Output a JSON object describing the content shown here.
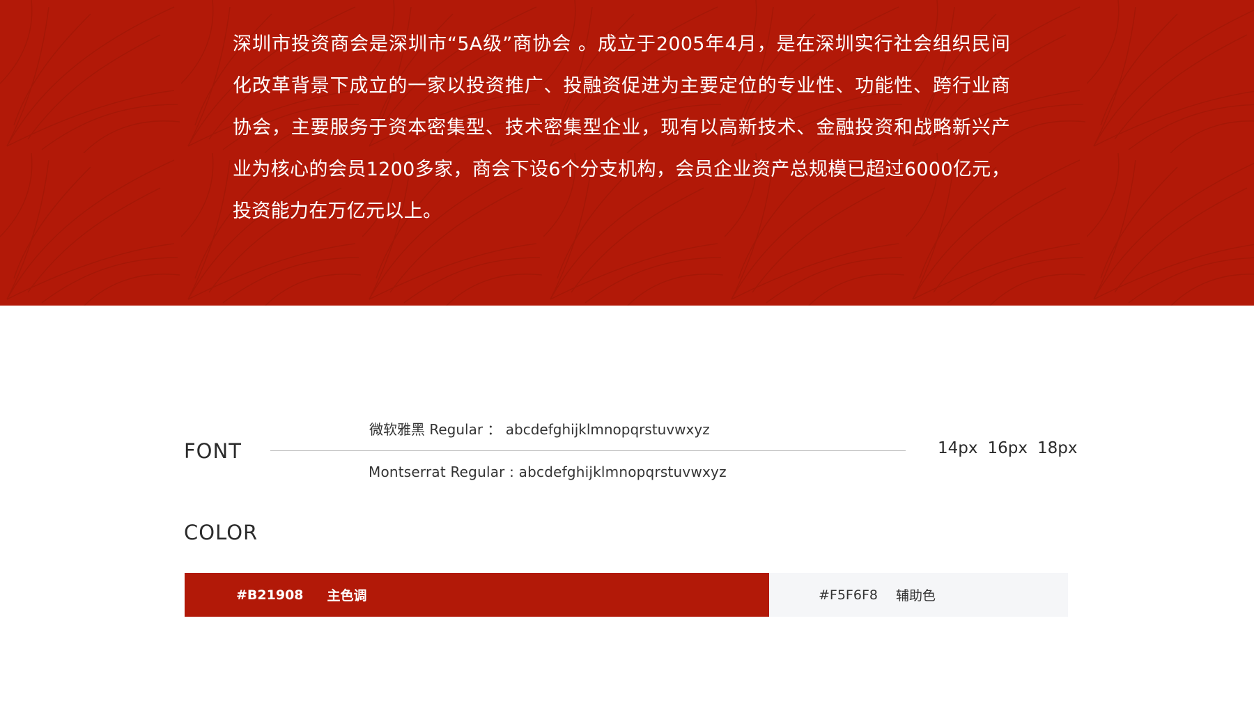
{
  "intro": {
    "text": "深圳市投资商会是深圳市“5A级”商协会 。成立于2005年4月，是在深圳实行社会组织民间化改革背景下成立的一家以投资推广、投融资促进为主要定位的专业性、功能性、跨行业商协会，主要服务于资本密集型、技术密集型企业，现有以高新技术、金融投资和战略新兴产业为核心的会员1200多家，商会下设6个分支机构，会员企业资产总规模已超过6000亿元，投资能力在万亿元以上。"
  },
  "font_spec": {
    "label": "FONT",
    "sample_cn": "微软雅黑 Regular ： abcdefghijklmnopqrstuvwxyz",
    "sample_en": "Montserrat Regular : abcdefghijklmnopqrstuvwxyz",
    "sizes": [
      "14px",
      "16px",
      "18px"
    ]
  },
  "color_spec": {
    "label": "COLOR",
    "primary": {
      "hex": "#B21908",
      "role": "主色调",
      "color": "#b21908"
    },
    "secondary": {
      "hex": "#F5F6F8",
      "role": "辅助色",
      "color": "#f5f6f8"
    }
  }
}
